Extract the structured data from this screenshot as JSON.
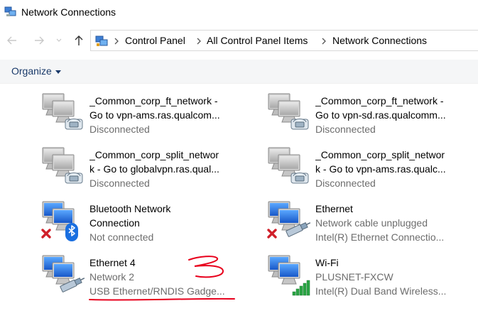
{
  "window": {
    "title": "Network Connections"
  },
  "address": {
    "crumbs": [
      "Control Panel",
      "All Control Panel Items",
      "Network Connections"
    ]
  },
  "toolbar": {
    "organize_label": "Organize"
  },
  "connections": [
    {
      "name": "_Common_corp_ft_network -",
      "name2": "Go to vpn-ams.ras.qualcom...",
      "status": "Disconnected",
      "icon": "vpn-connection-icon"
    },
    {
      "name": "_Common_corp_ft_network -",
      "name2": "Go to vpn-sd.ras.qualcomm...",
      "status": "Disconnected",
      "icon": "vpn-connection-icon"
    },
    {
      "name": "_Common_corp_split_networ",
      "name2": "k - Go to globalvpn.ras.qual...",
      "status": "Disconnected",
      "icon": "vpn-connection-icon"
    },
    {
      "name": "_Common_corp_split_networ",
      "name2": "k - Go to vpn-ams.ras.qualc...",
      "status": "Disconnected",
      "icon": "vpn-connection-icon"
    },
    {
      "name": "Bluetooth Network",
      "name2": "Connection",
      "status": "Not connected",
      "icon": "bluetooth-connection-icon"
    },
    {
      "name": "Ethernet",
      "status": "Network cable unplugged",
      "device": "Intel(R) Ethernet Connectio...",
      "icon": "ethernet-unplugged-icon"
    },
    {
      "name": "Ethernet 4",
      "status": "Network  2",
      "device": "USB Ethernet/RNDIS Gadge...",
      "icon": "ethernet-connected-icon"
    },
    {
      "name": "Wi-Fi",
      "status": "PLUSNET-FXCW",
      "device": "Intel(R) Dual Band Wireless...",
      "icon": "wifi-connection-icon"
    }
  ],
  "colors": {
    "annotation": "#e8001c",
    "status_text": "#6d6d6d",
    "accent": "#1a3a6a"
  }
}
